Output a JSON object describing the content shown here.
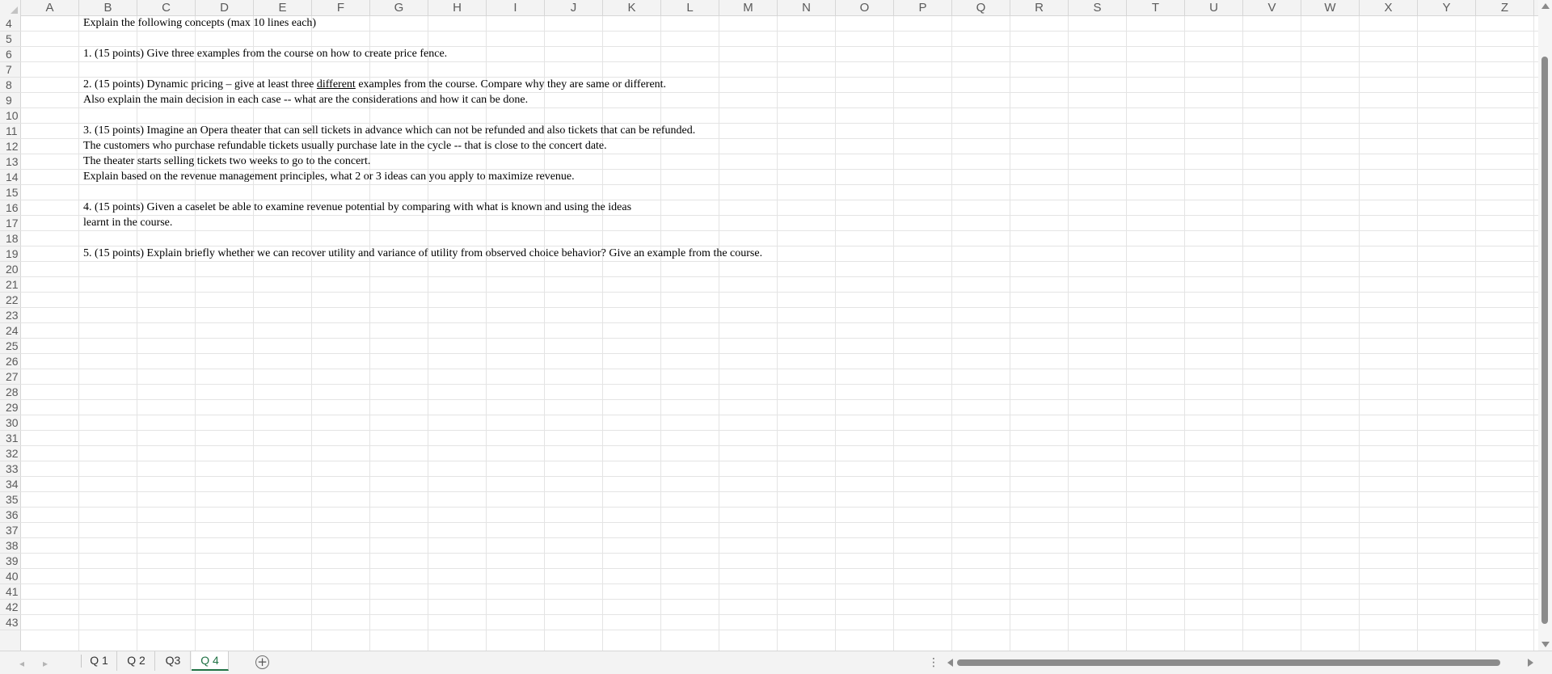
{
  "columns": [
    "A",
    "B",
    "C",
    "D",
    "E",
    "F",
    "G",
    "H",
    "I",
    "J",
    "K",
    "L",
    "M",
    "N",
    "O",
    "P",
    "Q",
    "R",
    "S",
    "T",
    "U",
    "V",
    "W",
    "X",
    "Y",
    "Z"
  ],
  "rows": [
    "4",
    "5",
    "6",
    "7",
    "8",
    "9",
    "10",
    "11",
    "12",
    "13",
    "14",
    "15",
    "16",
    "17",
    "18",
    "19",
    "20",
    "21",
    "22",
    "23",
    "24",
    "25",
    "26",
    "27",
    "28",
    "29",
    "30",
    "31",
    "32",
    "33",
    "34",
    "35",
    "36",
    "37",
    "38",
    "39",
    "40",
    "41",
    "42",
    "43"
  ],
  "cells": {
    "r4": "Explain the following concepts (max 10 lines each)",
    "r6": "1. (15 points) Give three examples from the course on how to create price fence.",
    "r8_pre": "2. (15 points) Dynamic pricing – give at least three ",
    "r8_under": "different",
    "r8_post": " examples from the course. Compare why they are same or different.",
    "r9": "Also explain the main decision in each case -- what are the considerations and how it can be done.",
    "r11": "3. (15 points) Imagine an Opera theater that can sell tickets in advance which can not be refunded and also tickets that can be refunded.",
    "r12": "The customers who purchase refundable tickets usually purchase late in the cycle -- that is close to the concert date.",
    "r13": "The theater starts selling tickets two weeks to go to the concert.",
    "r14": "Explain based on the revenue management principles, what 2 or 3 ideas can you apply to maximize revenue.",
    "r16": "4. (15 points) Given a caselet be able to examine revenue potential by comparing with what is known and using the ideas",
    "r17": "learnt in the course.",
    "r19": "5. (15 points) Explain briefly whether we can recover utility and variance of utility from observed choice behavior? Give an example from the course."
  },
  "sheet_tabs": [
    {
      "label": "Q 1",
      "active": false
    },
    {
      "label": "Q 2",
      "active": false
    },
    {
      "label": "Q3",
      "active": false
    },
    {
      "label": "Q 4",
      "active": true
    }
  ],
  "icons": {
    "nav_prev": "◂",
    "nav_next": "▸",
    "add_sheet": "+",
    "more": "⋮"
  },
  "colors": {
    "active_tab": "#217346",
    "grid": "#e4e4e4",
    "header_bg": "#f3f3f3"
  }
}
